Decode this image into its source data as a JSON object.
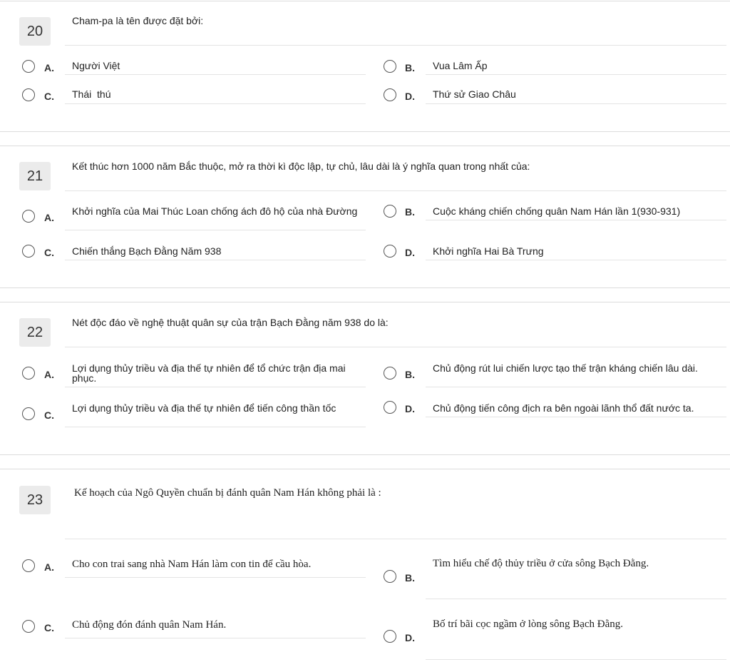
{
  "questions": [
    {
      "number": "20",
      "text": "Cham-pa là tên được đặt bởi:",
      "options": [
        {
          "letter": "A.",
          "text": "Người Việt"
        },
        {
          "letter": "B.",
          "text": "Vua Lâm Ấp"
        },
        {
          "letter": "C.",
          "text": "Thái  thú"
        },
        {
          "letter": "D.",
          "text": "Thứ sử Giao Châu"
        }
      ]
    },
    {
      "number": "21",
      "text": "Kết thúc hơn 1000 năm Bắc thuộc, mở ra thời kì độc lập, tự chủ, lâu dài là ý nghĩa quan trong nhất của:",
      "options": [
        {
          "letter": "A.",
          "text": "Khởi nghĩa của Mai Thúc Loan chống ách đô hộ của nhà Đường"
        },
        {
          "letter": "B.",
          "text": "Cuộc kháng chiến chống quân Nam Hán lần 1(930-931)"
        },
        {
          "letter": "C.",
          "text": "Chiến thắng Bạch Đằng Năm 938"
        },
        {
          "letter": "D.",
          "text": "Khởi nghĩa Hai Bà Trưng"
        }
      ]
    },
    {
      "number": "22",
      "text": "Nét độc đáo về nghệ thuật quân sự của trận Bạch Đằng năm 938 do là:",
      "options": [
        {
          "letter": "A.",
          "text": "Lợi dụng thủy triều và địa thế tự nhiên để tổ chức trận địa mai phục."
        },
        {
          "letter": "B.",
          "text": "Chủ động rút lui chiến lược tạo thế trận kháng chiến lâu dài."
        },
        {
          "letter": "C.",
          "text": "Lợi dụng thủy triều và địa thế tự nhiên để tiến công thần tốc"
        },
        {
          "letter": "D.",
          "text": "Chủ động tiến công địch ra bên ngoài lãnh thổ đất nước ta."
        }
      ]
    },
    {
      "number": "23",
      "text": "Kế hoạch của Ngô Quyền chuẩn bị đánh quân Nam Hán không phải là :",
      "options": [
        {
          "letter": "A.",
          "text": "Cho con trai sang nhà Nam Hán làm con tin để cầu hòa."
        },
        {
          "letter": "B.",
          "text": "Tìm hiểu chế độ thủy triều ở cửa sông Bạch Đằng."
        },
        {
          "letter": "C.",
          "text": "Chủ động đón đánh quân Nam Hán."
        },
        {
          "letter": "D.",
          "text": "Bố trí bãi cọc ngầm ở lòng sông Bạch Đằng."
        }
      ]
    }
  ]
}
